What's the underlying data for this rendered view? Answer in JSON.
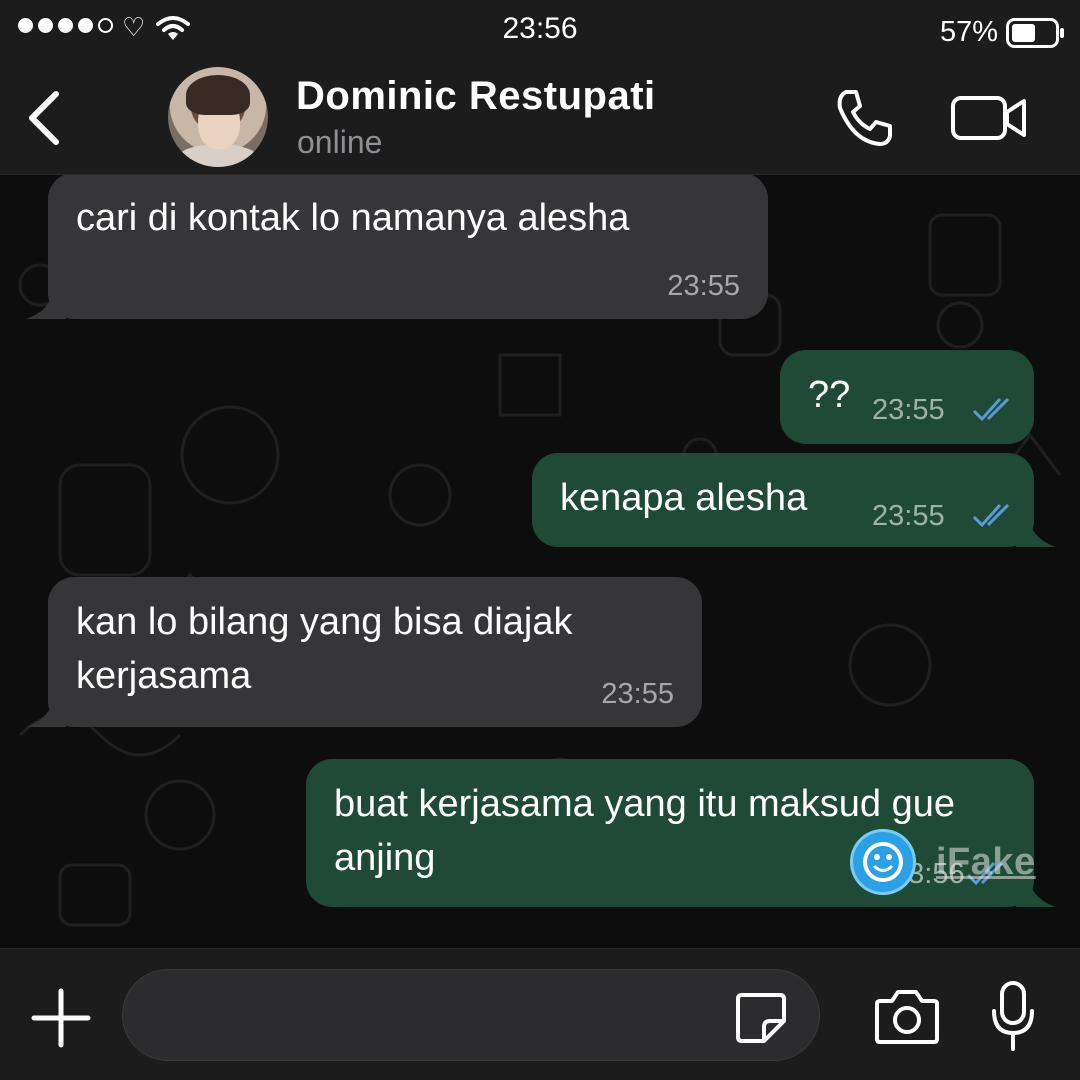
{
  "status_bar": {
    "time": "23:56",
    "battery_percent": "57%",
    "battery_level": 0.57,
    "signal_bars_filled": 4,
    "signal_bars_total": 5
  },
  "header": {
    "contact_name": "Dominic Restupati",
    "contact_status": "online"
  },
  "messages": [
    {
      "direction": "incoming",
      "text": "cari di kontak lo namanya alesha",
      "time": "23:55"
    },
    {
      "direction": "outgoing",
      "text": "??",
      "time": "23:55",
      "read": true
    },
    {
      "direction": "outgoing",
      "text": "kenapa alesha",
      "time": "23:55",
      "read": true
    },
    {
      "direction": "incoming",
      "text": "kan lo bilang yang bisa diajak kerjasama",
      "time": "23:55"
    },
    {
      "direction": "outgoing",
      "text": "buat kerjasama yang itu maksud gue anjing",
      "time": "23:56",
      "read": true
    }
  ],
  "watermark": {
    "text": "iFake"
  },
  "colors": {
    "incoming_bubble": "#363638",
    "outgoing_bubble": "#1f4a35",
    "read_ticks": "#5b9bd5",
    "bars": "#1c1c1d"
  },
  "icons": [
    "back-chevron-icon",
    "phone-icon",
    "video-camera-icon",
    "plus-icon",
    "sticker-icon",
    "camera-icon",
    "microphone-icon"
  ]
}
